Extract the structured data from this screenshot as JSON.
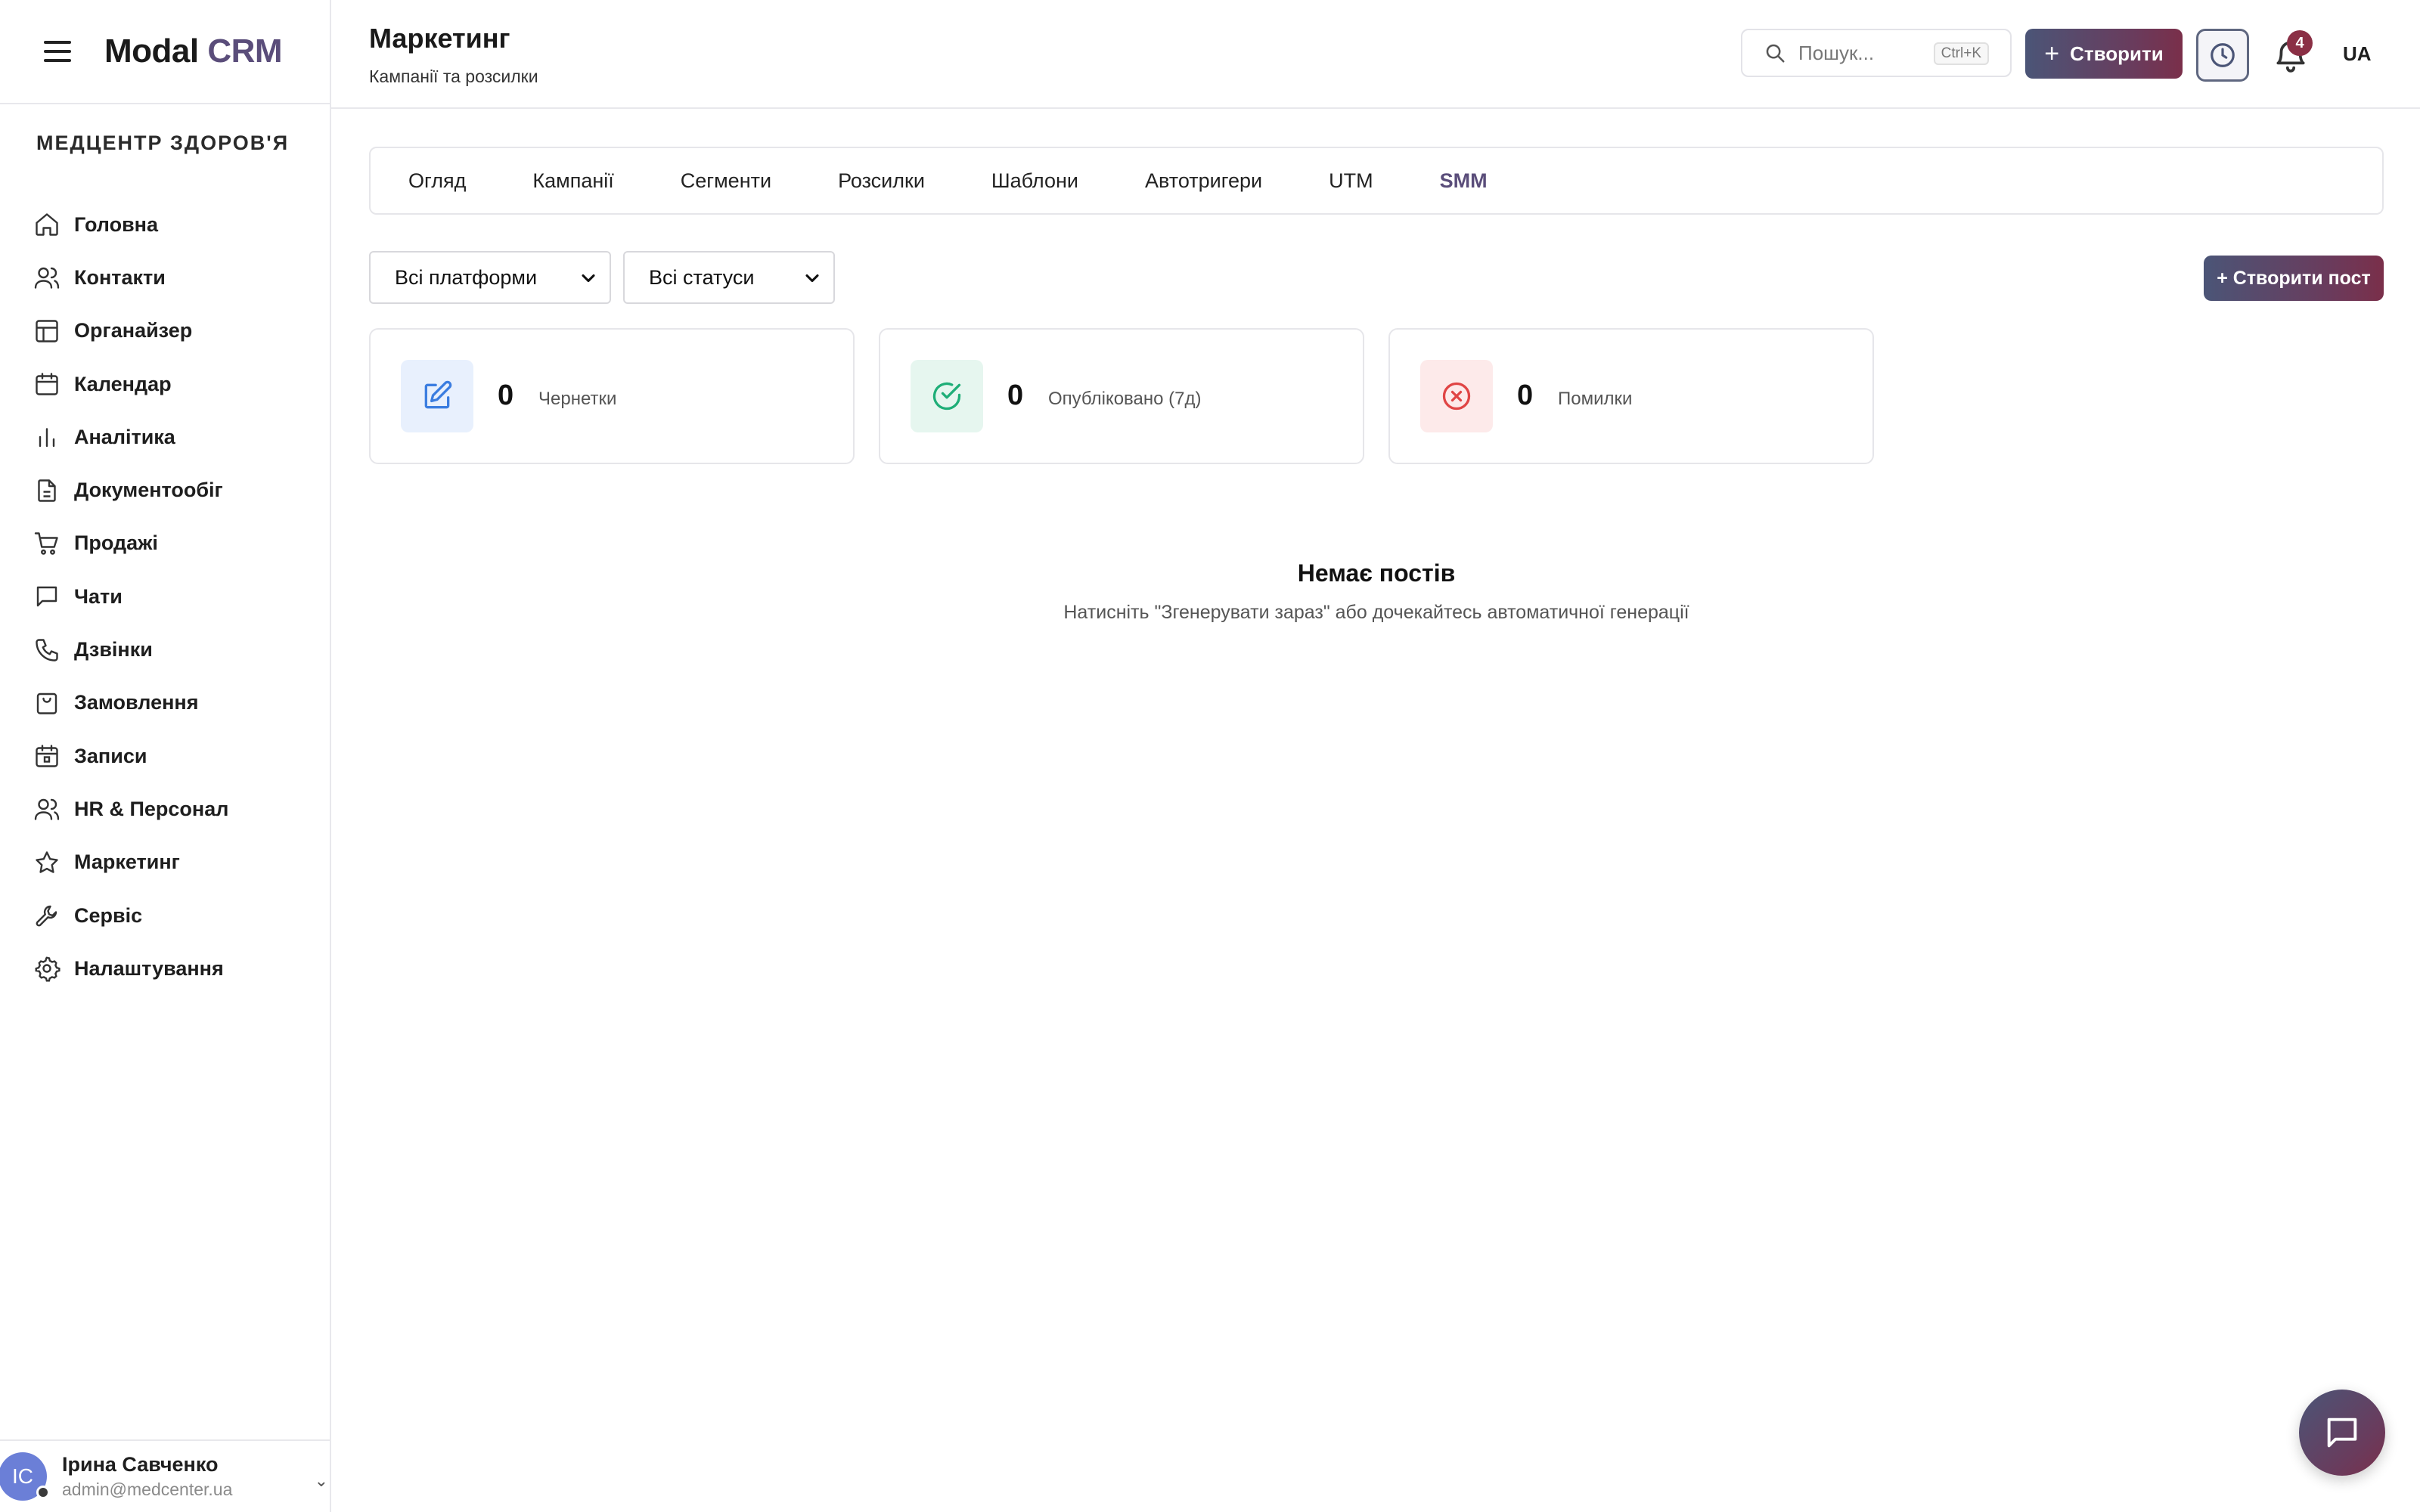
{
  "app": {
    "logo_main": "Modal",
    "logo_brand": "CRM"
  },
  "org": {
    "name": "МЕДЦЕНТР ЗДОРОВ'Я"
  },
  "sidebar": {
    "items": [
      {
        "label": "Головна",
        "icon": "home-icon"
      },
      {
        "label": "Контакти",
        "icon": "users-icon"
      },
      {
        "label": "Органайзер",
        "icon": "layout-icon"
      },
      {
        "label": "Календар",
        "icon": "calendar-icon"
      },
      {
        "label": "Аналітика",
        "icon": "bar-chart-icon"
      },
      {
        "label": "Документообіг",
        "icon": "document-icon"
      },
      {
        "label": "Продажі",
        "icon": "cart-icon"
      },
      {
        "label": "Чати",
        "icon": "chat-icon"
      },
      {
        "label": "Дзвінки",
        "icon": "phone-icon"
      },
      {
        "label": "Замовлення",
        "icon": "bag-icon"
      },
      {
        "label": "Записи",
        "icon": "calendar-check-icon"
      },
      {
        "label": "HR & Персонал",
        "icon": "people-icon"
      },
      {
        "label": "Маркетинг",
        "icon": "star-icon"
      },
      {
        "label": "Сервіс",
        "icon": "wrench-icon"
      },
      {
        "label": "Налаштування",
        "icon": "gear-icon"
      }
    ]
  },
  "user": {
    "initials": "IC",
    "name": "Ірина Савченко",
    "email": "admin@medcenter.ua"
  },
  "header": {
    "title": "Маркетинг",
    "subtitle": "Кампанії та розсилки",
    "search_placeholder": "Пошук...",
    "search_shortcut": "Ctrl+K",
    "create_label": "Створити",
    "notifications_count": "4",
    "language": "UA"
  },
  "tabs": [
    {
      "label": "Огляд",
      "active": false
    },
    {
      "label": "Кампанії",
      "active": false
    },
    {
      "label": "Сегменти",
      "active": false
    },
    {
      "label": "Розсилки",
      "active": false
    },
    {
      "label": "Шаблони",
      "active": false
    },
    {
      "label": "Автотригери",
      "active": false
    },
    {
      "label": "UTM",
      "active": false
    },
    {
      "label": "SMM",
      "active": true
    }
  ],
  "filters": {
    "platform": "Всі платформи",
    "status": "Всі статуси",
    "create_post_label": "+ Створити пост"
  },
  "stats": [
    {
      "value": "0",
      "label": "Чернетки",
      "icon": "edit-icon",
      "color": "#3b7de0",
      "bg": "#e8f0fd"
    },
    {
      "value": "0",
      "label": "Опубліковано (7д)",
      "icon": "check-circle-icon",
      "color": "#1fae78",
      "bg": "#e6f6ef"
    },
    {
      "value": "0",
      "label": "Помилки",
      "icon": "x-circle-icon",
      "color": "#e04545",
      "bg": "#fdeaea"
    }
  ],
  "empty": {
    "title": "Немає постів",
    "subtitle": "Натисніть \"Згенерувати зараз\" або дочекайтесь автоматичної генерації"
  },
  "colors": {
    "accent": "#5a4d7a",
    "gradient_start": "#4b5577",
    "gradient_end": "#7a2f4a"
  }
}
